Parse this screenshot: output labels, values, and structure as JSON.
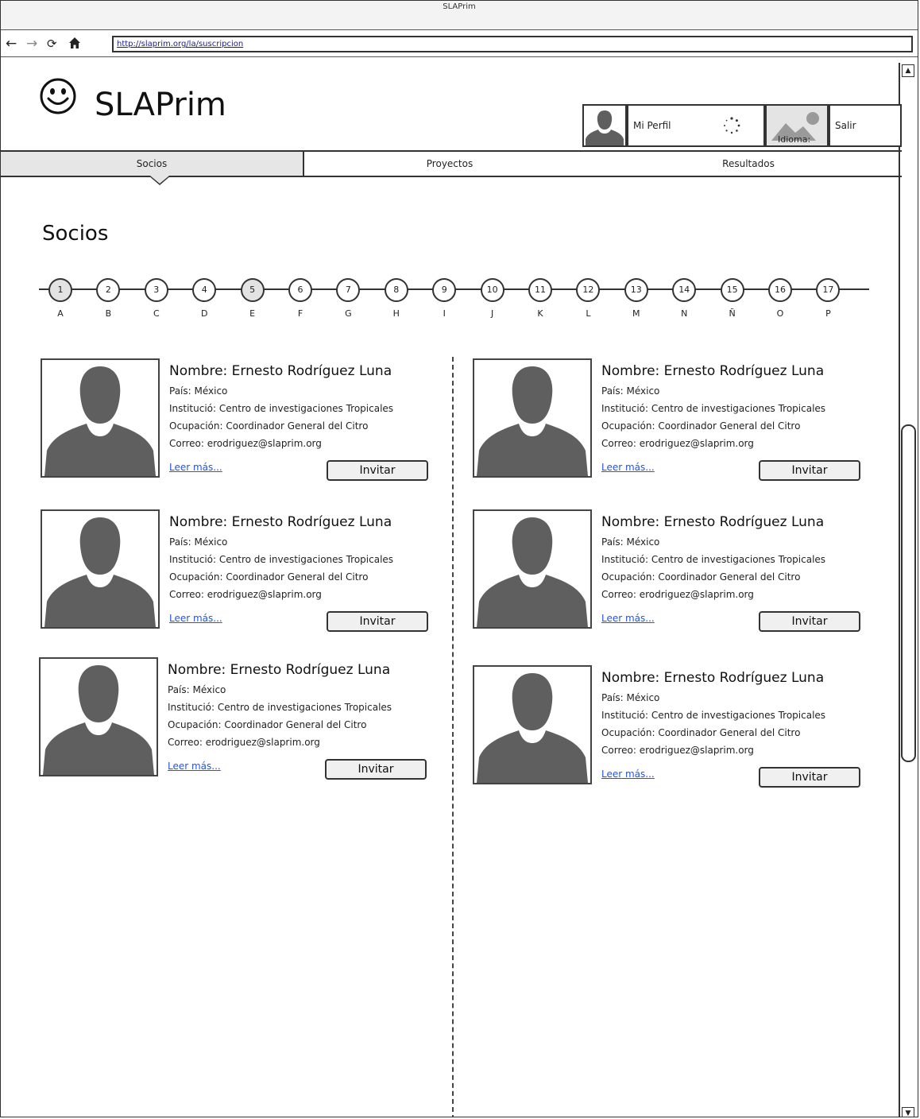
{
  "window": {
    "title": "SLAPrim"
  },
  "browser": {
    "url": "http://slaprim.org/la/suscripcion",
    "icons": [
      "back-arrow-icon",
      "forward-arrow-icon",
      "reload-icon",
      "home-icon"
    ]
  },
  "header": {
    "brand": "SLAPrim",
    "profile_label": "Mi Perfil",
    "language_label": "Idioma:",
    "logout_label": "Salir"
  },
  "tabs": [
    {
      "label": "Socios",
      "active": true
    },
    {
      "label": "Proyectos",
      "active": false
    },
    {
      "label": "Resultados",
      "active": false
    }
  ],
  "page": {
    "title": "Socios"
  },
  "stepper": {
    "steps": [
      {
        "number": "1",
        "letter": "A",
        "visited": true
      },
      {
        "number": "2",
        "letter": "B",
        "visited": false
      },
      {
        "number": "3",
        "letter": "C",
        "visited": false
      },
      {
        "number": "4",
        "letter": "D",
        "visited": false
      },
      {
        "number": "5",
        "letter": "E",
        "visited": true
      },
      {
        "number": "6",
        "letter": "F",
        "visited": false
      },
      {
        "number": "7",
        "letter": "G",
        "visited": false
      },
      {
        "number": "8",
        "letter": "H",
        "visited": false
      },
      {
        "number": "9",
        "letter": "I",
        "visited": false
      },
      {
        "number": "10",
        "letter": "J",
        "visited": false
      },
      {
        "number": "11",
        "letter": "K",
        "visited": false
      },
      {
        "number": "12",
        "letter": "L",
        "visited": false
      },
      {
        "number": "13",
        "letter": "M",
        "visited": false
      },
      {
        "number": "14",
        "letter": "N",
        "visited": false
      },
      {
        "number": "15",
        "letter": "Ñ",
        "visited": false
      },
      {
        "number": "16",
        "letter": "O",
        "visited": false
      },
      {
        "number": "17",
        "letter": "P",
        "visited": false
      }
    ]
  },
  "members": [
    {
      "name": "Nombre: Ernesto Rodríguez Luna",
      "country": "País: México",
      "institution": "Institució: Centro de investigaciones Tropicales",
      "occupation": "Ocupación: Coordinador General del Citro",
      "email": "Correo: erodriguez@slaprim.org",
      "more": "Leer más...",
      "invite": "Invitar"
    },
    {
      "name": "Nombre: Ernesto Rodríguez Luna",
      "country": "País: México",
      "institution": "Institució: Centro de investigaciones Tropicales",
      "occupation": "Ocupación: Coordinador General del Citro",
      "email": "Correo: erodriguez@slaprim.org",
      "more": "Leer más...",
      "invite": "Invitar"
    },
    {
      "name": "Nombre: Ernesto Rodríguez Luna",
      "country": "País: México",
      "institution": "Institució: Centro de investigaciones Tropicales",
      "occupation": "Ocupación: Coordinador General del Citro",
      "email": "Correo: erodriguez@slaprim.org",
      "more": "Leer más...",
      "invite": "Invitar"
    },
    {
      "name": "Nombre: Ernesto Rodríguez Luna",
      "country": "País: México",
      "institution": "Institució: Centro de investigaciones Tropicales",
      "occupation": "Ocupación: Coordinador General del Citro",
      "email": "Correo: erodriguez@slaprim.org",
      "more": "Leer más...",
      "invite": "Invitar"
    },
    {
      "name": "Nombre: Ernesto Rodríguez Luna",
      "country": "País: México",
      "institution": "Institució: Centro de investigaciones Tropicales",
      "occupation": "Ocupación: Coordinador General del Citro",
      "email": "Correo: erodriguez@slaprim.org",
      "more": "Leer más...",
      "invite": "Invitar"
    },
    {
      "name": "Nombre: Ernesto Rodríguez Luna",
      "country": "País: México",
      "institution": "Institució: Centro de investigaciones Tropicales",
      "occupation": "Ocupación: Coordinador General del Citro",
      "email": "Correo: erodriguez@slaprim.org",
      "more": "Leer más...",
      "invite": "Invitar"
    }
  ],
  "colors": {
    "link": "#2255dd",
    "silhouette": "#5f5f5f",
    "active_tab": "#e6e6e6",
    "border": "#333333"
  }
}
